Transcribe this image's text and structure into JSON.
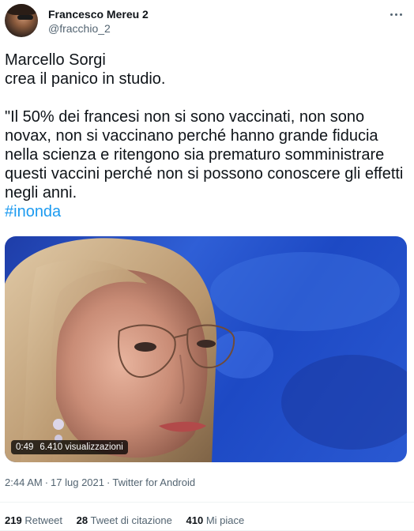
{
  "author": {
    "display_name": "Francesco Mereu 2",
    "handle": "@fracchio_2"
  },
  "tweet": {
    "line1": "Marcello Sorgi",
    "line2": "crea il panico in studio.",
    "quote": "\"Il 50% dei francesi non si sono vaccinati, non sono novax, non si vaccinano perché hanno grande fiducia nella scienza e ritengono sia prematuro somministrare questi vaccini perché non si possono conoscere gli effetti negli anni.",
    "hashtag": "#inonda"
  },
  "media": {
    "duration": "0:49",
    "views": "6.410 visualizzazioni"
  },
  "meta": {
    "time": "2:44 AM",
    "date": "17 lug 2021",
    "source": "Twitter for Android",
    "separator": "·"
  },
  "stats": {
    "retweets_count": "219",
    "retweets_label": "Retweet",
    "quotes_count": "28",
    "quotes_label": "Tweet di citazione",
    "likes_count": "410",
    "likes_label": "Mi piace"
  }
}
